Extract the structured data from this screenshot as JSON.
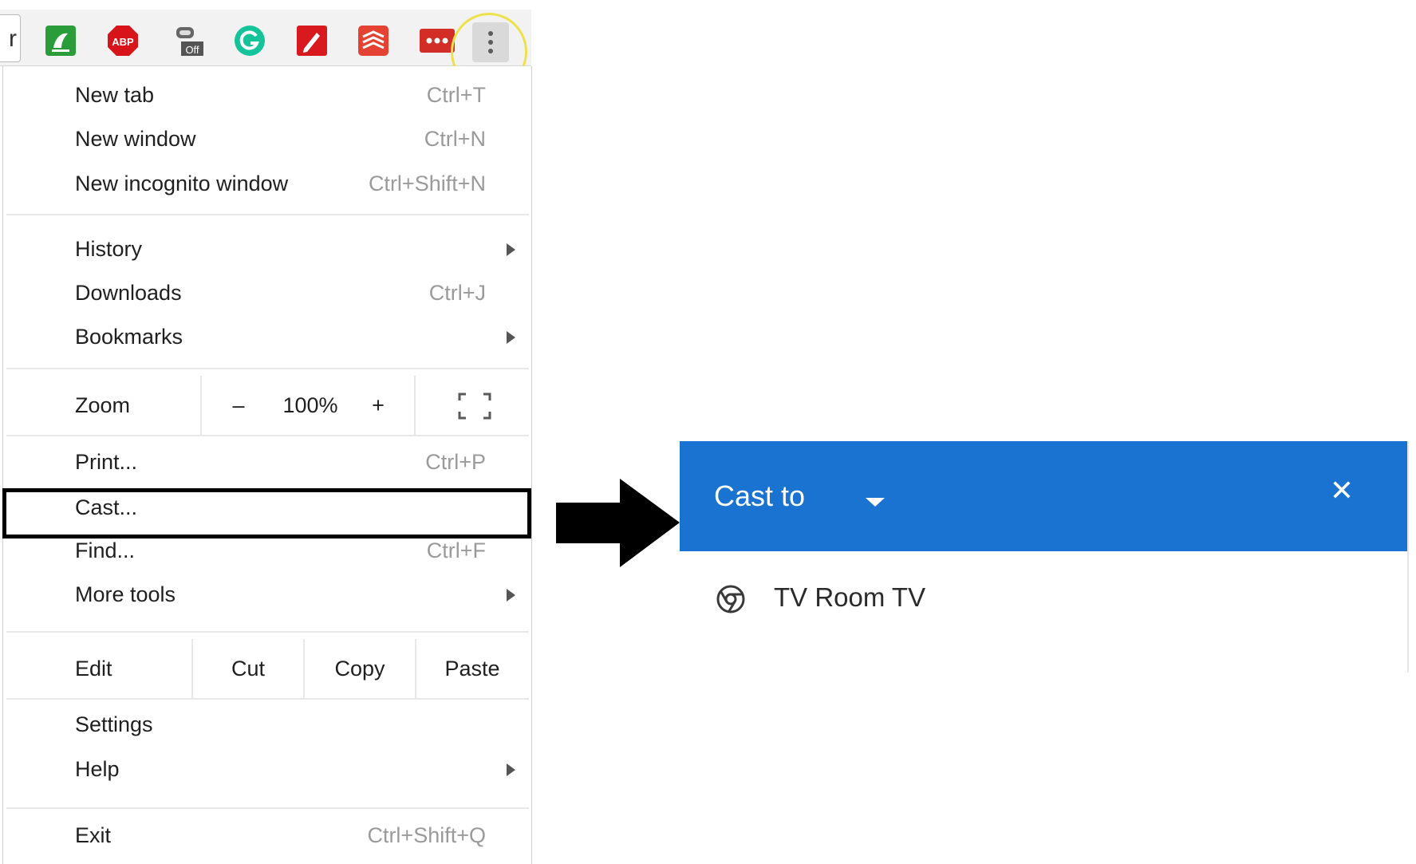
{
  "toolbar": {
    "omnibox_edge_glyph": "r",
    "extensions": [
      {
        "icon": "evernote-icon",
        "color": "#2a9d3a"
      },
      {
        "icon": "adblock-plus-icon",
        "color": "#d8141b",
        "text": "ABP"
      },
      {
        "icon": "extension-off-icon",
        "badge": "Off"
      },
      {
        "icon": "grammarly-icon",
        "color": "#15c39a"
      },
      {
        "icon": "pen-icon",
        "color": "#d8191e"
      },
      {
        "icon": "todoist-icon",
        "color": "#e44232"
      },
      {
        "icon": "lastpass-icon",
        "color": "#d32d27",
        "text": "•••"
      }
    ],
    "menu_button": "more-vertical-icon",
    "highlight_color": "#ede14b"
  },
  "menu": {
    "new_tab": {
      "label": "New tab",
      "shortcut": "Ctrl+T"
    },
    "new_window": {
      "label": "New window",
      "shortcut": "Ctrl+N"
    },
    "new_incognito": {
      "label": "New incognito window",
      "shortcut": "Ctrl+Shift+N"
    },
    "history": {
      "label": "History"
    },
    "downloads": {
      "label": "Downloads",
      "shortcut": "Ctrl+J"
    },
    "bookmarks": {
      "label": "Bookmarks"
    },
    "zoom": {
      "label": "Zoom",
      "minus": "–",
      "value": "100%",
      "plus": "+"
    },
    "print": {
      "label": "Print...",
      "shortcut": "Ctrl+P"
    },
    "cast": {
      "label": "Cast..."
    },
    "find": {
      "label": "Find...",
      "shortcut": "Ctrl+F"
    },
    "more_tools": {
      "label": "More tools"
    },
    "edit": {
      "label": "Edit",
      "cut": "Cut",
      "copy": "Copy",
      "paste": "Paste"
    },
    "settings": {
      "label": "Settings"
    },
    "help": {
      "label": "Help"
    },
    "exit": {
      "label": "Exit",
      "shortcut": "Ctrl+Shift+Q"
    }
  },
  "cast_dialog": {
    "title": "Cast to",
    "close_glyph": "✕",
    "sinks": [
      {
        "name": "TV Room TV",
        "icon": "chrome-cast-icon"
      }
    ],
    "header_color": "#1a73d0"
  }
}
